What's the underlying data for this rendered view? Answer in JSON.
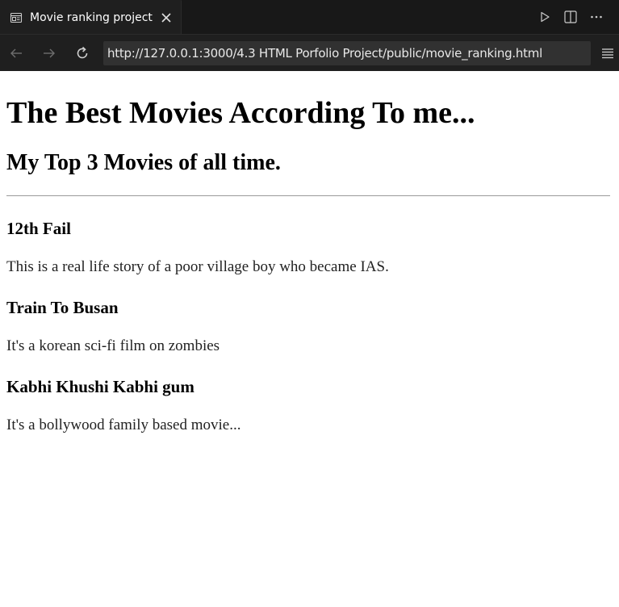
{
  "tab": {
    "title": "Movie ranking project"
  },
  "address_bar": {
    "url": "http://127.0.0.1:3000/4.3 HTML Porfolio Project/public/movie_ranking.html"
  },
  "page": {
    "heading": "The Best Movies According To me...",
    "subheading": "My Top 3 Movies of all time.",
    "movies": [
      {
        "title": "12th Fail",
        "description": "This is a real life story of a poor village boy who became IAS."
      },
      {
        "title": "Train To Busan",
        "description": "It's a korean sci-fi film on zombies"
      },
      {
        "title": "Kabhi Khushi Kabhi gum",
        "description": "It's a bollywood family based movie..."
      }
    ]
  },
  "icons": {
    "tab": "browser-preview-icon",
    "close": "close-icon",
    "run": "play-icon",
    "split": "split-editor-icon",
    "more": "more-actions-icon",
    "back": "arrow-left-icon",
    "forward": "arrow-right-icon",
    "reload": "reload-icon",
    "menu": "menu-icon"
  },
  "colors": {
    "chrome_background": "#1f1f1f",
    "tabbar_background": "#181818",
    "url_background": "#313131",
    "page_background": "#ffffff"
  }
}
